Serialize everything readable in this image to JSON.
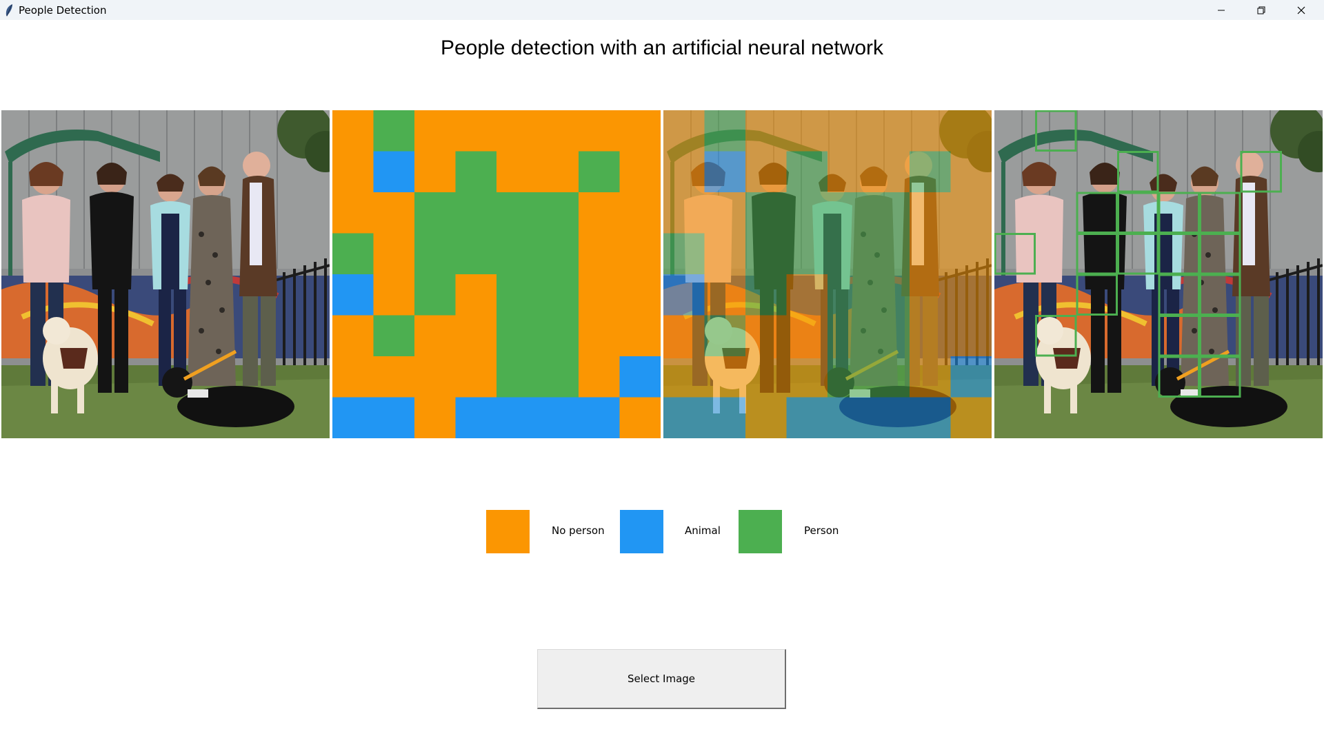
{
  "window": {
    "title": "People Detection",
    "icon": "feather-icon",
    "controls": [
      "minimize-icon",
      "restore-icon",
      "close-icon"
    ]
  },
  "heading": "People detection with an artificial neural network",
  "panels": [
    {
      "name": "original-image",
      "kind": "photo"
    },
    {
      "name": "classification-grid",
      "kind": "grid"
    },
    {
      "name": "overlay-image",
      "kind": "photo-overlay"
    },
    {
      "name": "person-outline-image",
      "kind": "photo-outline"
    }
  ],
  "grid": {
    "rows": 8,
    "cols": 8,
    "cells": [
      "NPNNNNNN",
      "NANPNNPN",
      "NNPPPPNN",
      "PNPPPPNN",
      "ANPNPPNN",
      "NPNNPPNN",
      "NNNNPPNA",
      "AANAAAAN"
    ]
  },
  "legend": [
    {
      "label": "No person",
      "color": "#fb9602"
    },
    {
      "label": "Animal",
      "color": "#2196f3"
    },
    {
      "label": "Person",
      "color": "#4caf50"
    }
  ],
  "colors": {
    "no_person": "#fb9602",
    "animal": "#2196f3",
    "person": "#4caf50"
  },
  "button": {
    "label": "Select Image"
  }
}
